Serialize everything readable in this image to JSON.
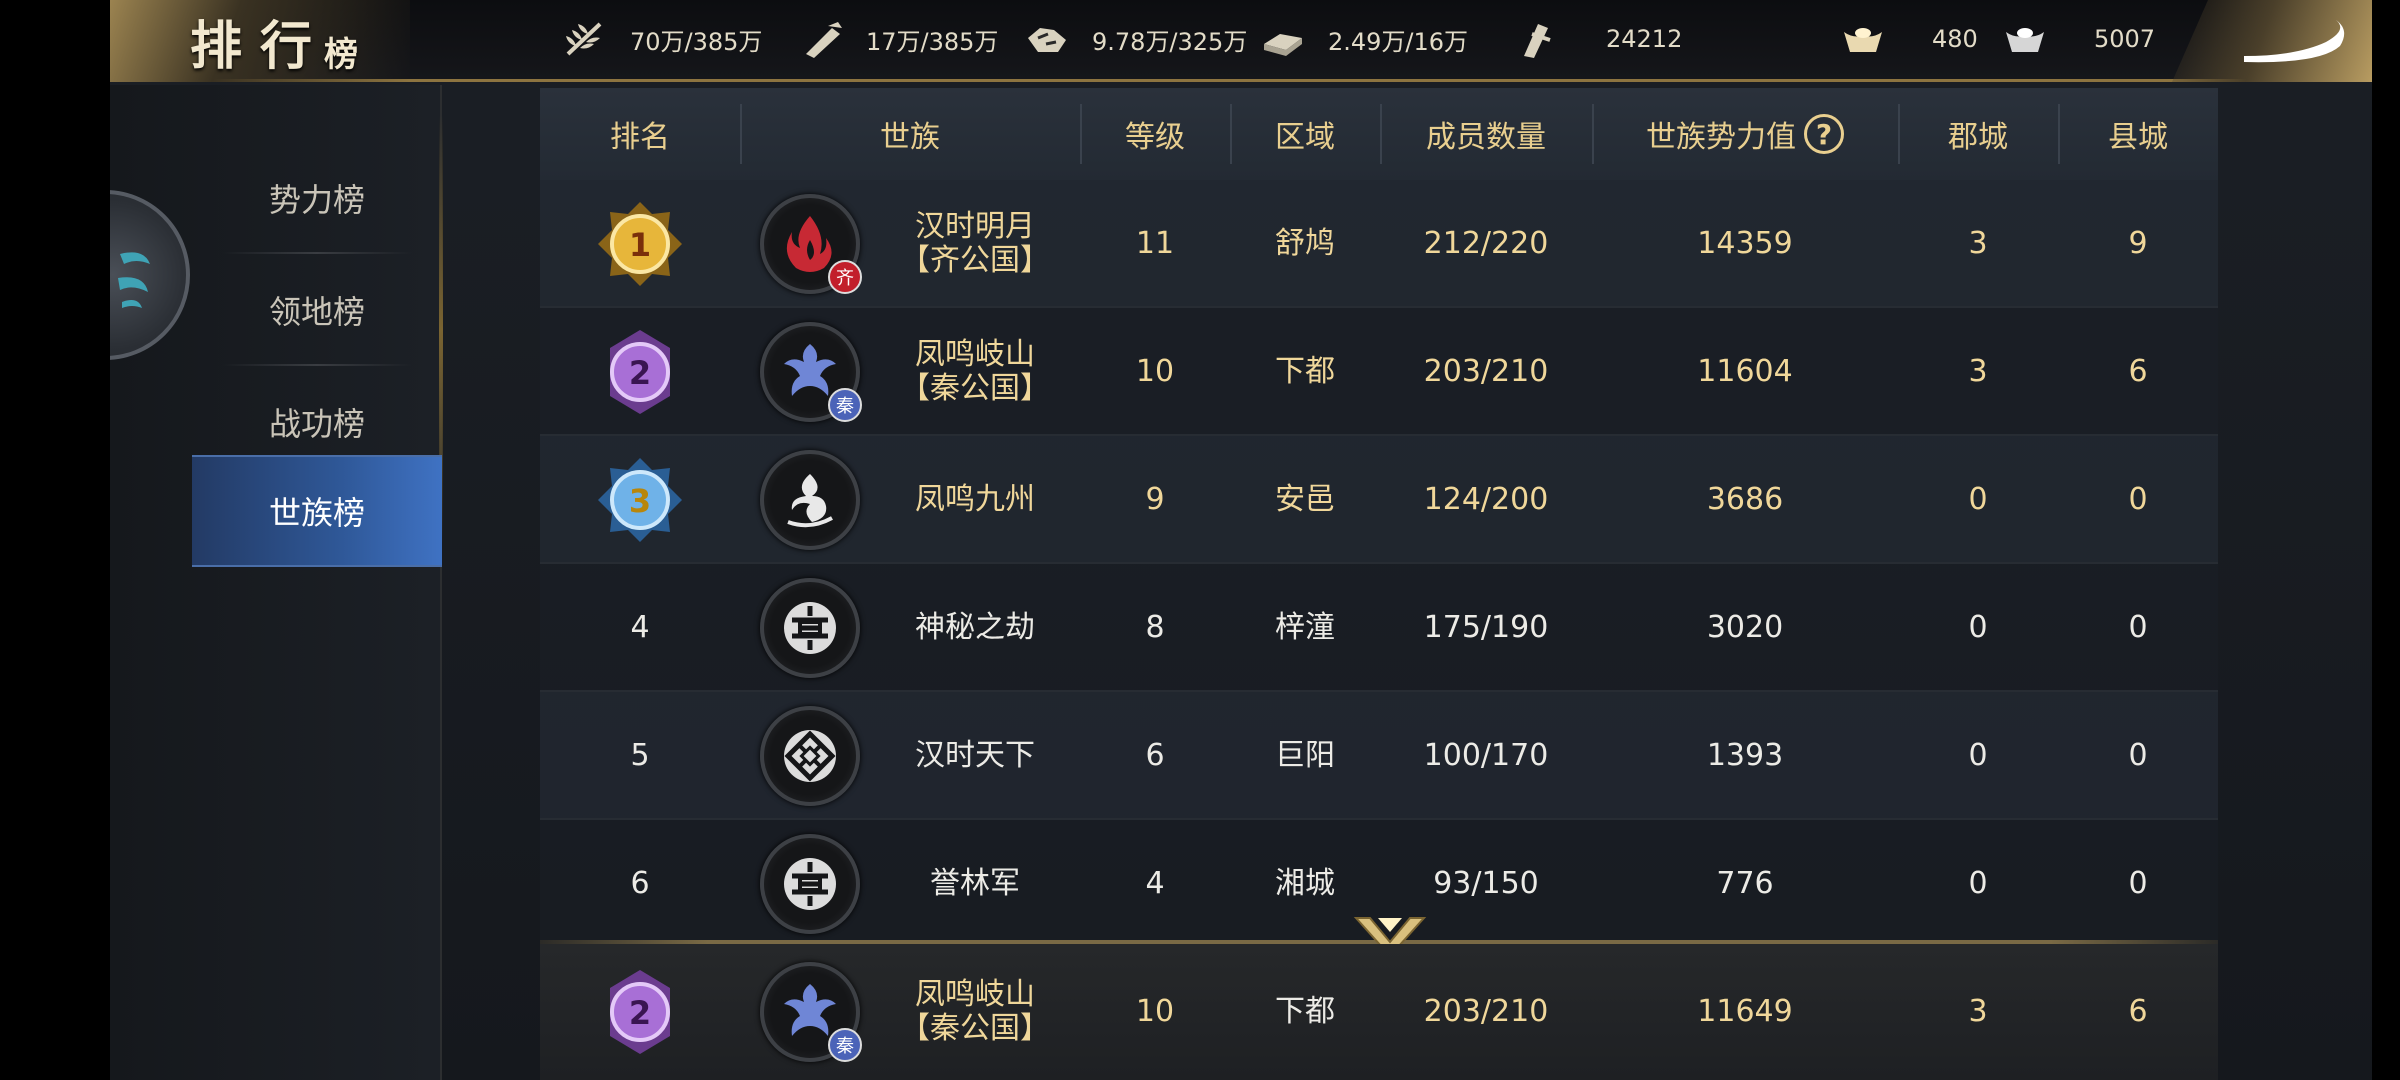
{
  "header": {
    "title_main": "排行",
    "title_suffix": "榜",
    "resources": [
      {
        "icon": "grain-icon",
        "value": "70万/385万"
      },
      {
        "icon": "wood-icon",
        "value": "17万/385万"
      },
      {
        "icon": "stone-icon",
        "value": "9.78万/325万"
      },
      {
        "icon": "iron-icon",
        "value": "2.49万/16万"
      },
      {
        "icon": "token-icon",
        "value": "24212"
      },
      {
        "icon": "gold-ingot-icon",
        "value": "480"
      },
      {
        "icon": "silver-ingot-icon",
        "value": "5007"
      }
    ]
  },
  "nav": {
    "items": [
      {
        "label": "势力榜",
        "active": false
      },
      {
        "label": "领地榜",
        "active": false
      },
      {
        "label": "战功榜",
        "active": false
      },
      {
        "label": "世族榜",
        "active": true
      }
    ]
  },
  "table": {
    "columns": [
      "排名",
      "世族",
      "等级",
      "区域",
      "成员数量",
      "世族势力值",
      "郡城",
      "县城"
    ],
    "rows": [
      {
        "rank": "1",
        "name": "汉时明月\n【齐公国】",
        "level": "11",
        "region": "舒鸠",
        "members": "212/220",
        "power": "14359",
        "commandery": "3",
        "county": "9",
        "emblem": "flame-emblem-icon",
        "badge": "齐"
      },
      {
        "rank": "2",
        "name": "凤鸣岐山\n【秦公国】",
        "level": "10",
        "region": "下都",
        "members": "203/210",
        "power": "11604",
        "commandery": "3",
        "county": "6",
        "emblem": "phoenix-emblem-icon",
        "badge": "秦"
      },
      {
        "rank": "3",
        "name": "凤鸣九州",
        "level": "9",
        "region": "安邑",
        "members": "124/200",
        "power": "3686",
        "commandery": "0",
        "county": "0",
        "emblem": "swirl-emblem-icon",
        "badge": ""
      },
      {
        "rank": "4",
        "name": "神秘之劫",
        "level": "8",
        "region": "梓潼",
        "members": "175/190",
        "power": "3020",
        "commandery": "0",
        "county": "0",
        "emblem": "shou-emblem-icon",
        "badge": ""
      },
      {
        "rank": "5",
        "name": "汉时天下",
        "level": "6",
        "region": "巨阳",
        "members": "100/170",
        "power": "1393",
        "commandery": "0",
        "county": "0",
        "emblem": "knot-emblem-icon",
        "badge": ""
      },
      {
        "rank": "6",
        "name": "誉林军",
        "level": "4",
        "region": "湘城",
        "members": "93/150",
        "power": "776",
        "commandery": "0",
        "county": "0",
        "emblem": "shou-emblem-icon",
        "badge": ""
      }
    ],
    "my_row": {
      "rank": "2",
      "name": "凤鸣岐山\n【秦公国】",
      "level": "10",
      "region": "下都",
      "members": "203/210",
      "power": "11649",
      "commandery": "3",
      "county": "6",
      "emblem": "phoenix-emblem-icon",
      "badge": "秦"
    }
  },
  "colors": {
    "gold_text": "#f0d79a",
    "header_text": "#e9cf8f",
    "active_tab": "#2f5898"
  }
}
